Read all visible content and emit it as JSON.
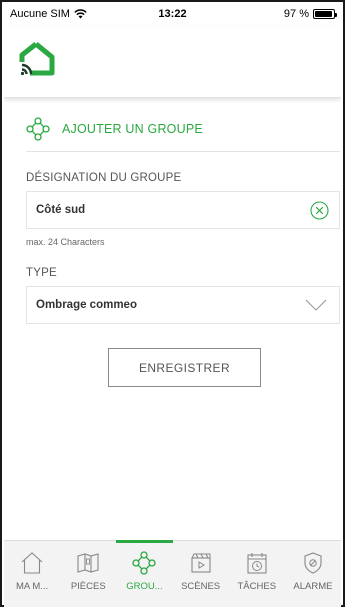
{
  "status_bar": {
    "carrier": "Aucune SIM",
    "time": "13:22",
    "battery": "97 %"
  },
  "add_group": {
    "label": "AJOUTER UN GROUPE"
  },
  "group_name": {
    "label": "DÉSIGNATION DU GROUPE",
    "value": "Côté sud",
    "hint": "max. 24 Characters"
  },
  "type": {
    "label": "TYPE",
    "value": "Ombrage commeo"
  },
  "save_label": "ENREGISTRER",
  "accent_color": "#2aa841",
  "tabs": [
    {
      "label": "MA M...",
      "icon": "home-icon",
      "active": false
    },
    {
      "label": "PIÈCES",
      "icon": "rooms-icon",
      "active": false
    },
    {
      "label": "GROU...",
      "icon": "groups-icon",
      "active": true
    },
    {
      "label": "SCÈNES",
      "icon": "scenes-icon",
      "active": false
    },
    {
      "label": "TÂCHES",
      "icon": "tasks-icon",
      "active": false
    },
    {
      "label": "ALARME",
      "icon": "alarm-icon",
      "active": false
    }
  ]
}
